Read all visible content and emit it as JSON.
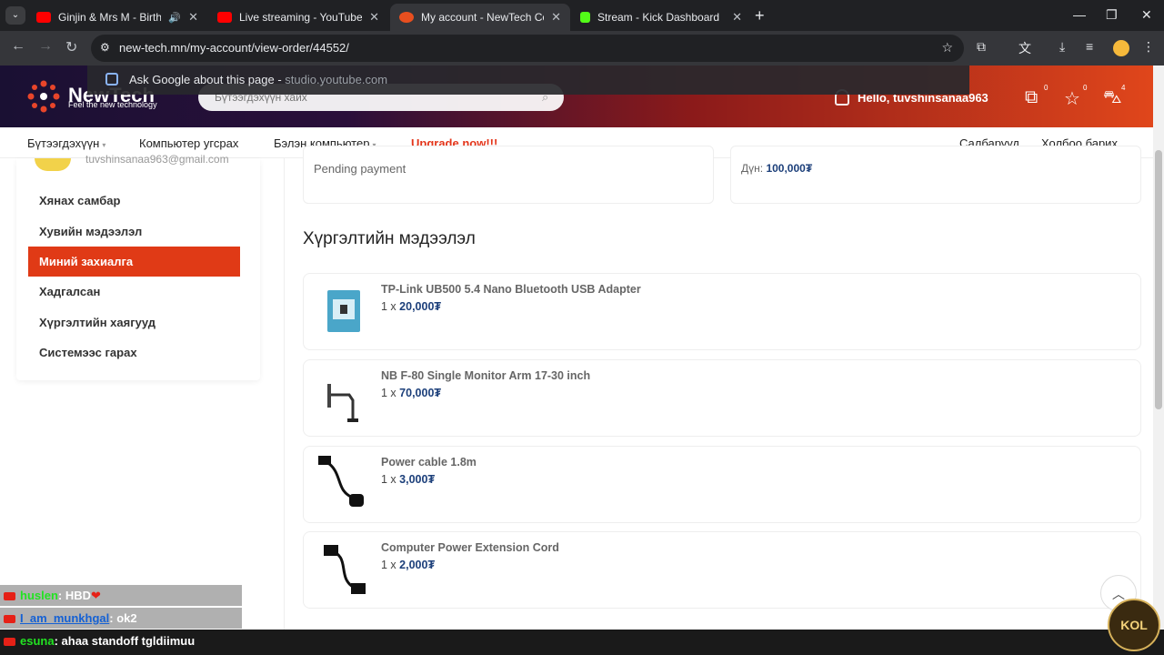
{
  "browser": {
    "tabs": [
      {
        "title": "Ginjin & Mrs M - Birthday (",
        "favicon_color": "#ff0000"
      },
      {
        "title": "Live streaming - YouTube Studio",
        "favicon_color": "#ff0000"
      },
      {
        "title": "My account - NewTech Comput",
        "favicon_color": "#e84f1f",
        "active": true
      },
      {
        "title": "Stream - Kick Dashboard",
        "favicon_color": "#53fc18"
      }
    ],
    "url": "new-tech.mn/my-account/view-order/44552/",
    "suggestion": {
      "text": "Ask Google about this page",
      "source": "studio.youtube.com"
    }
  },
  "site": {
    "logo_text": "NewTech",
    "logo_tagline": "Feel the new technology",
    "search_placeholder": "Бүтээгдэхүүн хайх",
    "greeting": "Hello, tuvshinsanaa963",
    "badges": {
      "compare": "0",
      "wishlist": "0",
      "cart": "4"
    },
    "nav": [
      {
        "label": "Бүтээгдэхүүн",
        "dropdown": true
      },
      {
        "label": "Компьютер угсрах",
        "dropdown": false
      },
      {
        "label": "Бэлэн компьютер",
        "dropdown": true
      },
      {
        "label": "Upgrade now!!!",
        "dropdown": false
      }
    ],
    "nav_right": [
      "Салбарууд",
      "Холбоо барих"
    ]
  },
  "account": {
    "email": "tuvshinsanaa963@gmail.com",
    "menu": [
      {
        "label": "Хянах самбар"
      },
      {
        "label": "Хувийн мэдээлэл"
      },
      {
        "label": "Миний захиалга",
        "active": true
      },
      {
        "label": "Хадгалсан"
      },
      {
        "label": "Хүргэлтийн хаягууд"
      },
      {
        "label": "Системээс гарах"
      }
    ]
  },
  "order": {
    "status": "Pending payment",
    "total_label": "Дүн:",
    "total_value": "100,000₮",
    "section_title": "Хүргэлтийн мэдээлэл",
    "items": [
      {
        "name": "TP-Link UB500 5.4 Nano Bluetooth USB Adapter",
        "qty": "1 x",
        "price": "20,000₮",
        "icon": "usb-adapter-icon"
      },
      {
        "name": "NB F-80 Single Monitor Arm 17-30 inch",
        "qty": "1 x",
        "price": "70,000₮",
        "icon": "monitor-arm-icon"
      },
      {
        "name": "Power cable 1.8m",
        "qty": "1 x",
        "price": "3,000₮",
        "icon": "power-cable-icon"
      },
      {
        "name": "Computer Power Extension Cord",
        "qty": "1 x",
        "price": "2,000₮",
        "icon": "extension-cord-icon"
      }
    ]
  },
  "chat": [
    {
      "user": "huslen",
      "message": ": HBD",
      "heart": "❤"
    },
    {
      "user": "I_am_munkhgal",
      "message": ": ok2"
    },
    {
      "user": "esuna",
      "message": ": ahaa standoff tgldiimuu"
    }
  ],
  "watermark": "KOL",
  "colors": {
    "accent": "#e03a16",
    "price": "#1c3f7a",
    "header_from": "#1a1033",
    "header_to": "#e0461b"
  }
}
